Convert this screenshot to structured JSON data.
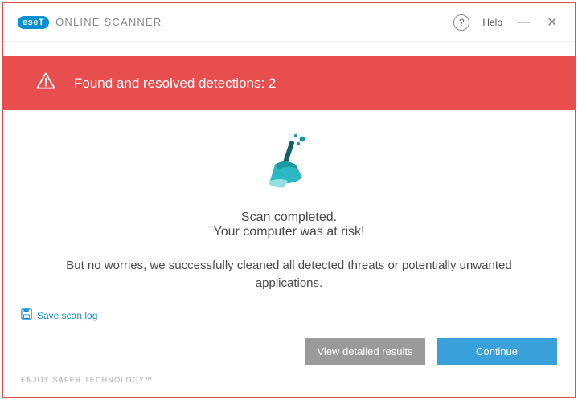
{
  "titlebar": {
    "logo_badge": "eseT",
    "logo_text": "ONLINE SCANNER",
    "help_label": "Help"
  },
  "alert": {
    "text": "Found and resolved detections: 2"
  },
  "content": {
    "status_line1": "Scan completed.",
    "status_line2": "Your computer was at risk!",
    "description": "But no worries, we successfully cleaned all detected threats or potentially unwanted applications."
  },
  "footer": {
    "save_log_label": "Save scan log",
    "view_results_label": "View detailed results",
    "continue_label": "Continue",
    "tagline": "ENJOY SAFER TECHNOLOGY™"
  }
}
